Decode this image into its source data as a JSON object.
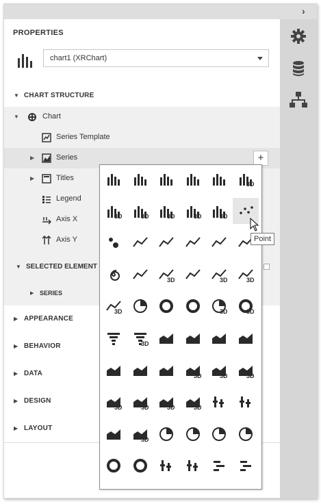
{
  "panel": {
    "title": "PROPERTIES",
    "selector_value": "chart1 (XRChart)"
  },
  "chart_structure": {
    "header": "CHART STRUCTURE",
    "items": [
      {
        "label": "Chart",
        "icon": "chart-icon"
      },
      {
        "label": "Series Template",
        "icon": "series-template-icon"
      },
      {
        "label": "Series",
        "icon": "series-icon"
      },
      {
        "label": "Titles",
        "icon": "titles-icon"
      },
      {
        "label": "Legend",
        "icon": "legend-icon"
      },
      {
        "label": "Axis X",
        "icon": "axis-x-icon"
      },
      {
        "label": "Axis Y",
        "icon": "axis-y-icon"
      }
    ],
    "add_button": "+"
  },
  "selected_element": {
    "header": "SELECTED ELEMENT",
    "child": "SERIES"
  },
  "sections": [
    "APPEARANCE",
    "BEHAVIOR",
    "DATA",
    "DESIGN",
    "LAYOUT"
  ],
  "right_toolbar": [
    "gear-icon",
    "database-icon",
    "hierarchy-icon"
  ],
  "series_gallery": {
    "items": [
      "bar-icon",
      "stacked-bar-icon",
      "full-stacked-bar-icon",
      "side-by-side-stacked-bar-icon",
      "side-by-side-full-stacked-bar-icon",
      "bar-3d-icon",
      "stacked-bar-3d-icon",
      "full-stacked-bar-3d-icon",
      "side-by-side-stacked-bar-3d-icon",
      "side-by-side-full-stacked-bar-3d-icon",
      "manhattan-bar-3d-icon",
      "point-icon",
      "bubble-icon",
      "line-icon",
      "stacked-line-icon",
      "step-line-icon",
      "step-line-2-icon",
      "spline-icon",
      "spiral-icon",
      "scatter-line-icon",
      "line-3d-icon",
      "full-stacked-line-icon",
      "step-line-3d-icon",
      "step-line-3d-2-icon",
      "spline-3d-icon",
      "pie-icon",
      "doughnut-icon",
      "nested-doughnut-icon",
      "pie-3d-icon",
      "doughnut-3d-icon",
      "funnel-icon",
      "funnel-3d-icon",
      "area-icon",
      "stacked-area-icon",
      "full-stacked-area-icon",
      "step-area-icon",
      "spline-area-icon",
      "stacked-spline-area-icon",
      "full-stacked-spline-area-icon",
      "area-3d-icon",
      "stacked-area-3d-icon",
      "full-stacked-area-3d-icon",
      "step-area-3d-icon",
      "spline-area-3d-icon",
      "stacked-spline-area-3d-icon",
      "full-stacked-spline-area-3d-icon",
      "range-bar-icon",
      "side-by-side-range-bar-icon",
      "range-area-icon",
      "range-area-3d-icon",
      "radar-point-icon",
      "radar-line-icon",
      "radar-area-icon",
      "polar-point-icon",
      "polar-line-icon",
      "polar-area-icon",
      "stock-icon",
      "candle-stick-icon",
      "gantt-icon",
      "side-by-side-gantt-icon"
    ],
    "hover_index": 11,
    "tooltip": "Point"
  },
  "colors": {
    "icon": "#2a2a2a",
    "hover": "#e6e6e6",
    "sidebar": "#d6d6d6"
  }
}
